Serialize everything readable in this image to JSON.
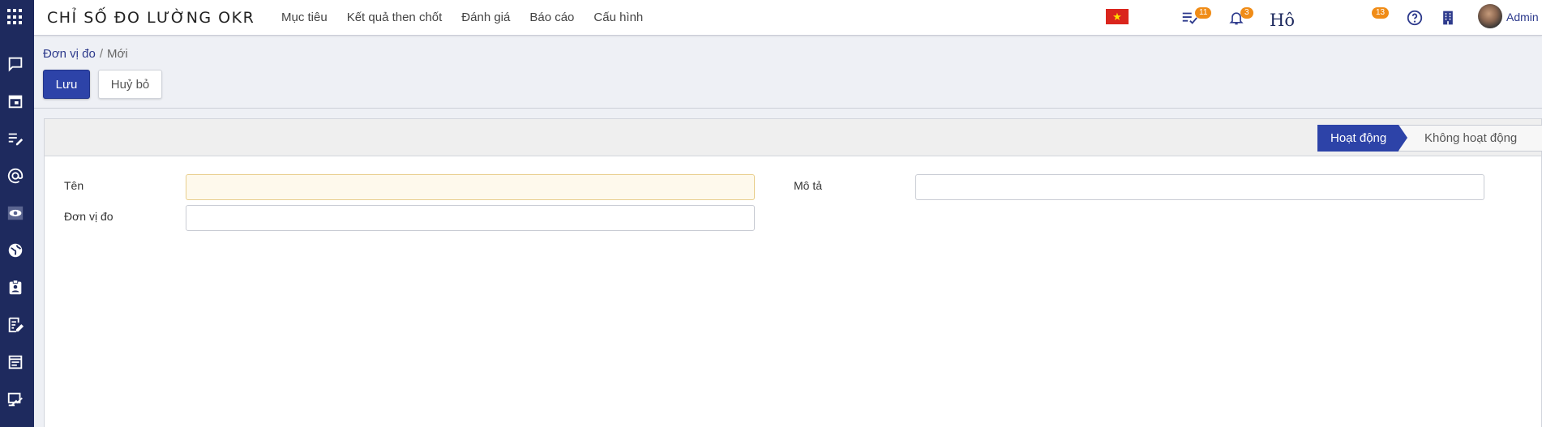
{
  "app": {
    "title": "CHỈ SỐ ĐO LƯỜNG OKR"
  },
  "menu": [
    "Mục tiêu",
    "Kết quả then chốt",
    "Đánh giá",
    "Báo cáo",
    "Cấu hình"
  ],
  "topbar": {
    "flag_icon": "vietnam-flag-icon",
    "activities_badge": "11",
    "notifications_badge": "3",
    "logo_text": "Hô",
    "chat_badge": "13",
    "user_name": "Admin"
  },
  "breadcrumb": {
    "parent": "Đơn vị đo",
    "separator": "/",
    "current": "Mới"
  },
  "buttons": {
    "save": "Lưu",
    "discard": "Huỷ bỏ"
  },
  "statusbar": {
    "active": "Hoạt động",
    "inactive": "Không hoạt động"
  },
  "form": {
    "name_label": "Tên",
    "name_value": "",
    "unit_label": "Đơn vị đo",
    "unit_value": "",
    "description_label": "Mô tả",
    "description_value": ""
  },
  "sidebar_icons": [
    "chat-icon",
    "calendar-icon",
    "edit-list-icon",
    "at-sign-icon",
    "eye-icon",
    "globe-icon",
    "contact-badge-icon",
    "note-edit-icon",
    "document-icon",
    "presentation-icon"
  ],
  "colors": {
    "sidebar": "#1e2a5e",
    "primary": "#2d43a8",
    "badge": "#f08c17",
    "required_field": "#fef9ec"
  }
}
